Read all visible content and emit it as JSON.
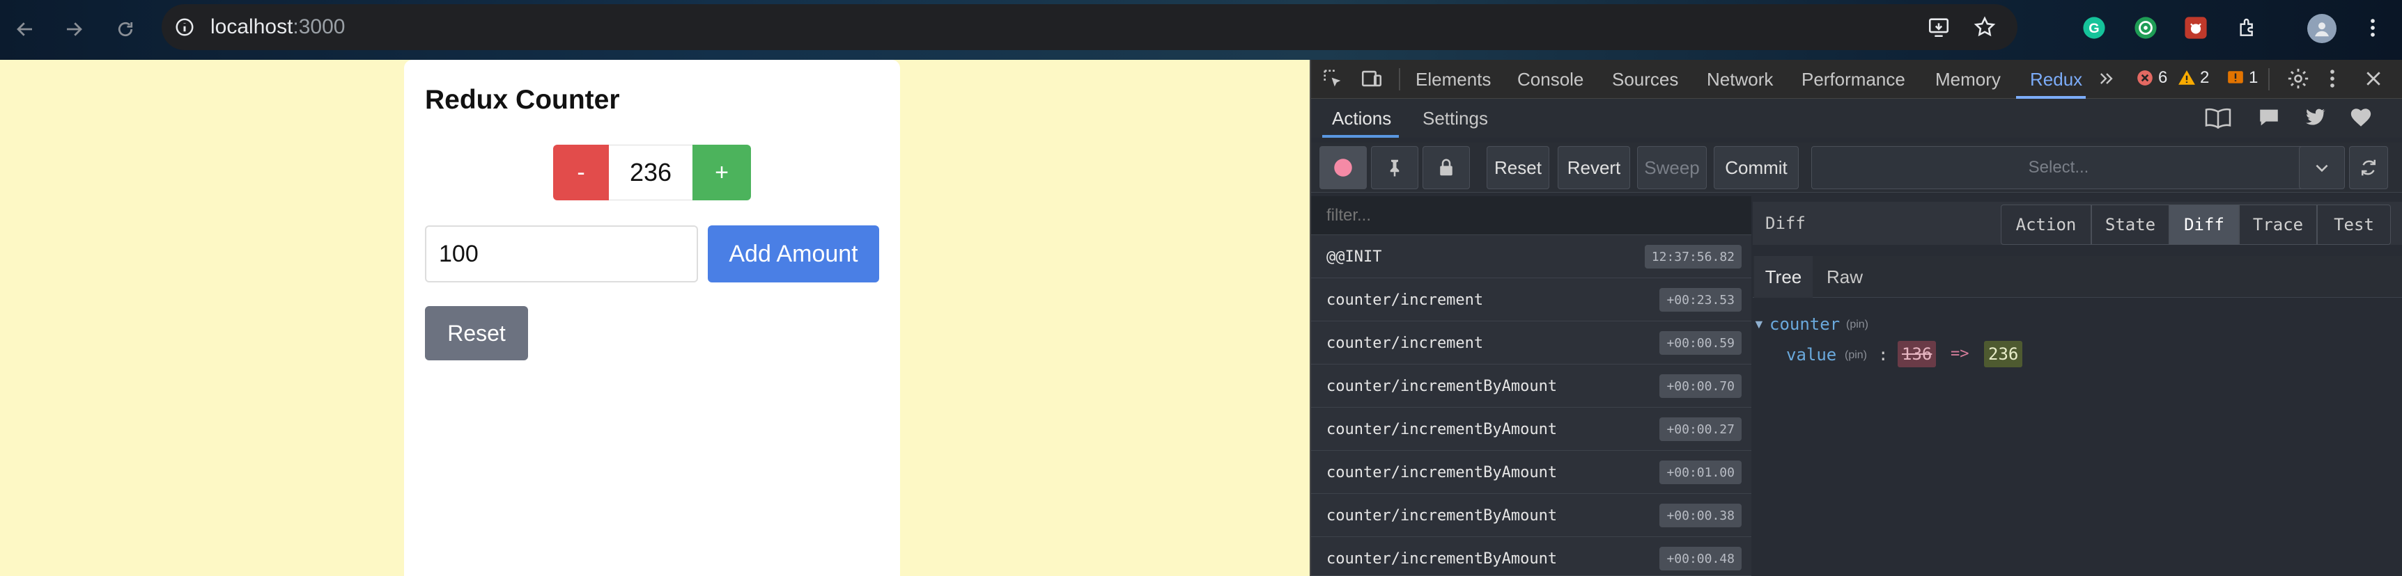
{
  "browser": {
    "url_host": "localhost",
    "url_port": ":3000"
  },
  "app": {
    "title": "Redux Counter",
    "decrement_label": "-",
    "count": "236",
    "increment_label": "+",
    "amount_value": "100",
    "add_amount_label": "Add Amount",
    "reset_label": "Reset",
    "colors": {
      "decrement": "#e24c4b",
      "increment": "#4cb35c",
      "add_amount": "#4a7fe5",
      "reset": "#6c7280",
      "page_bg": "#fdf8c5"
    }
  },
  "devtools": {
    "tabs": [
      "Elements",
      "Console",
      "Sources",
      "Network",
      "Performance",
      "Memory",
      "Redux"
    ],
    "active_tab": "Redux",
    "errors": "6",
    "warnings": "2",
    "issues": "1"
  },
  "redux": {
    "tabs": [
      "Actions",
      "Settings"
    ],
    "toolbar": {
      "reset": "Reset",
      "revert": "Revert",
      "sweep": "Sweep",
      "commit": "Commit",
      "select_placeholder": "Select..."
    },
    "filter_placeholder": "filter...",
    "actions": [
      {
        "name": "@@INIT",
        "time": "12:37:56.82"
      },
      {
        "name": "counter/increment",
        "time": "+00:23.53"
      },
      {
        "name": "counter/increment",
        "time": "+00:00.59"
      },
      {
        "name": "counter/incrementByAmount",
        "time": "+00:00.70"
      },
      {
        "name": "counter/incrementByAmount",
        "time": "+00:00.27"
      },
      {
        "name": "counter/incrementByAmount",
        "time": "+00:01.00"
      },
      {
        "name": "counter/incrementByAmount",
        "time": "+00:00.38"
      },
      {
        "name": "counter/incrementByAmount",
        "time": "+00:00.48"
      }
    ],
    "view": {
      "title": "Diff",
      "tabs": [
        "Action",
        "State",
        "Diff",
        "Trace",
        "Test"
      ],
      "subtabs": [
        "Tree",
        "Raw"
      ]
    },
    "diff": {
      "key": "counter",
      "pin": "(pin)",
      "value_key": "value",
      "colon": ":",
      "old": "136",
      "arrow": "=>",
      "new": "236"
    }
  }
}
